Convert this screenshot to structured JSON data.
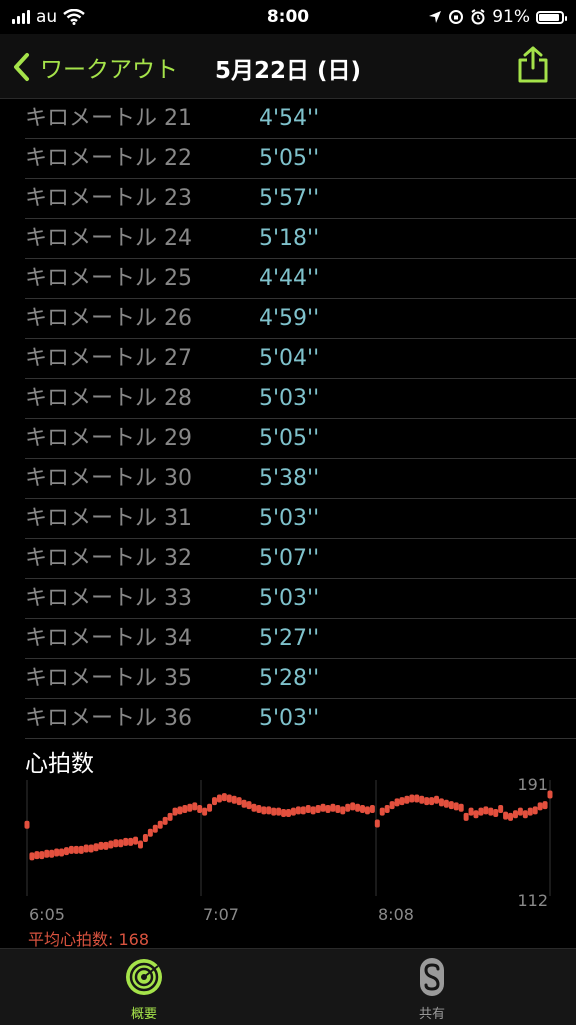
{
  "status": {
    "carrier": "au",
    "time": "8:00",
    "battery": "91%",
    "battery_level": 0.91
  },
  "nav": {
    "back_label": "ワークアウト",
    "title": "5月22日 (日)"
  },
  "splits": [
    {
      "label": "キロメートル 21",
      "pace": "4'54''"
    },
    {
      "label": "キロメートル 22",
      "pace": "5'05''"
    },
    {
      "label": "キロメートル 23",
      "pace": "5'57''"
    },
    {
      "label": "キロメートル 24",
      "pace": "5'18''"
    },
    {
      "label": "キロメートル 25",
      "pace": "4'44''"
    },
    {
      "label": "キロメートル 26",
      "pace": "4'59''"
    },
    {
      "label": "キロメートル 27",
      "pace": "5'04''"
    },
    {
      "label": "キロメートル 28",
      "pace": "5'03''"
    },
    {
      "label": "キロメートル 29",
      "pace": "5'05''"
    },
    {
      "label": "キロメートル 30",
      "pace": "5'38''"
    },
    {
      "label": "キロメートル 31",
      "pace": "5'03''"
    },
    {
      "label": "キロメートル 32",
      "pace": "5'07''"
    },
    {
      "label": "キロメートル 33",
      "pace": "5'03''"
    },
    {
      "label": "キロメートル 34",
      "pace": "5'27''"
    },
    {
      "label": "キロメートル 35",
      "pace": "5'28''"
    },
    {
      "label": "キロメートル 36",
      "pace": "5'03''"
    }
  ],
  "heart_rate": {
    "title": "心拍数",
    "average_label": "平均心拍数: 168",
    "color": "#e3503e"
  },
  "chart_data": {
    "type": "scatter",
    "x_tick_labels": [
      "6:05",
      "7:07",
      "8:08"
    ],
    "y_max_label": "191",
    "y_min_label": "112",
    "ylim": [
      112,
      191
    ],
    "series": [
      {
        "y": [
          160,
          136,
          137,
          137,
          138,
          138,
          139,
          139,
          140,
          141,
          141,
          141,
          142,
          142,
          143,
          144,
          144,
          145,
          146,
          146,
          147,
          147,
          148,
          145,
          150,
          154,
          157,
          160,
          163,
          166,
          170,
          171,
          172,
          173,
          174,
          172,
          170,
          173,
          178,
          180,
          181,
          180,
          179,
          178,
          176,
          175,
          173,
          172,
          171,
          171,
          170,
          170,
          169,
          169,
          170,
          171,
          171,
          172,
          171,
          172,
          173,
          172,
          173,
          172,
          171,
          173,
          174,
          173,
          172,
          171,
          172,
          161,
          170,
          172,
          175,
          177,
          178,
          179,
          180,
          180,
          179,
          178,
          178,
          179,
          177,
          176,
          175,
          174,
          173,
          166,
          170,
          168,
          170,
          171,
          170,
          169,
          172,
          167,
          166,
          168,
          170,
          168,
          170,
          171,
          174,
          175,
          183
        ]
      }
    ],
    "legend": "none",
    "grid": "vertical-lines"
  },
  "tabs": [
    {
      "label": "概要",
      "active": true,
      "color": "#a5e34a"
    },
    {
      "label": "共有",
      "active": false,
      "color": "#9a9a9a"
    }
  ]
}
